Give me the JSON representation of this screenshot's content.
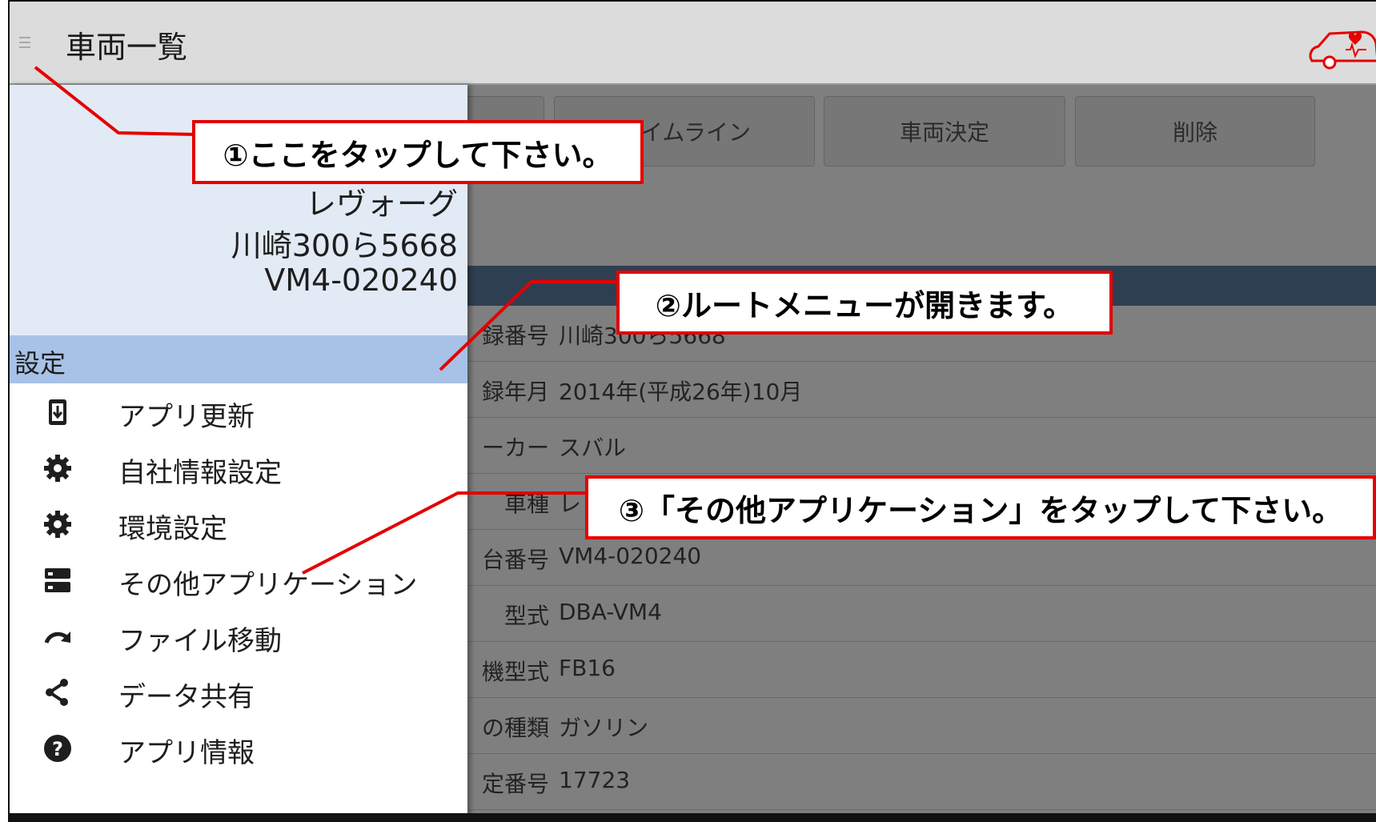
{
  "app_bar": {
    "title": "車両一覧",
    "menu_icon": "hamburger-menu-icon",
    "logo_icon": "car-heart-logo-icon"
  },
  "toolbar": {
    "buttons": [
      "タイムライン",
      "車両決定",
      "削除"
    ]
  },
  "vehicle_details": [
    {
      "label": "録番号",
      "value": "川崎300ら5668"
    },
    {
      "label": "録年月",
      "value": "2014年(平成26年)10月"
    },
    {
      "label": "ーカー",
      "value": "スバル"
    },
    {
      "label": "車種",
      "value": "レ"
    },
    {
      "label": "台番号",
      "value": "VM4-020240"
    },
    {
      "label": "型式",
      "value": "DBA-VM4"
    },
    {
      "label": "機型式",
      "value": "FB16"
    },
    {
      "label": "の種類",
      "value": "ガソリン"
    },
    {
      "label": "定番号",
      "value": "17723"
    }
  ],
  "drawer": {
    "vehicle_name": "レヴォーグ",
    "plate": "川崎300ら5668",
    "chassis": "VM4-020240",
    "section_title": "設定",
    "items": [
      {
        "label": "アプリ更新",
        "icon": "app-update-icon"
      },
      {
        "label": "自社情報設定",
        "icon": "gear-icon"
      },
      {
        "label": "環境設定",
        "icon": "gear-icon"
      },
      {
        "label": "その他アプリケーション",
        "icon": "apps-list-icon"
      },
      {
        "label": "ファイル移動",
        "icon": "redo-arrow-icon"
      },
      {
        "label": "データ共有",
        "icon": "share-icon"
      },
      {
        "label": "アプリ情報",
        "icon": "help-icon"
      }
    ]
  },
  "callouts": {
    "step1": "①ここをタップして下さい。",
    "step2": "②ルートメニューが開きます。",
    "step3": "③「その他アプリケーション」をタップして下さい。"
  },
  "colors": {
    "callout_border": "#e40000",
    "drawer_header_bg": "#e2eaf5",
    "section_bg": "#a7c2e6",
    "logo": "#e40000"
  }
}
